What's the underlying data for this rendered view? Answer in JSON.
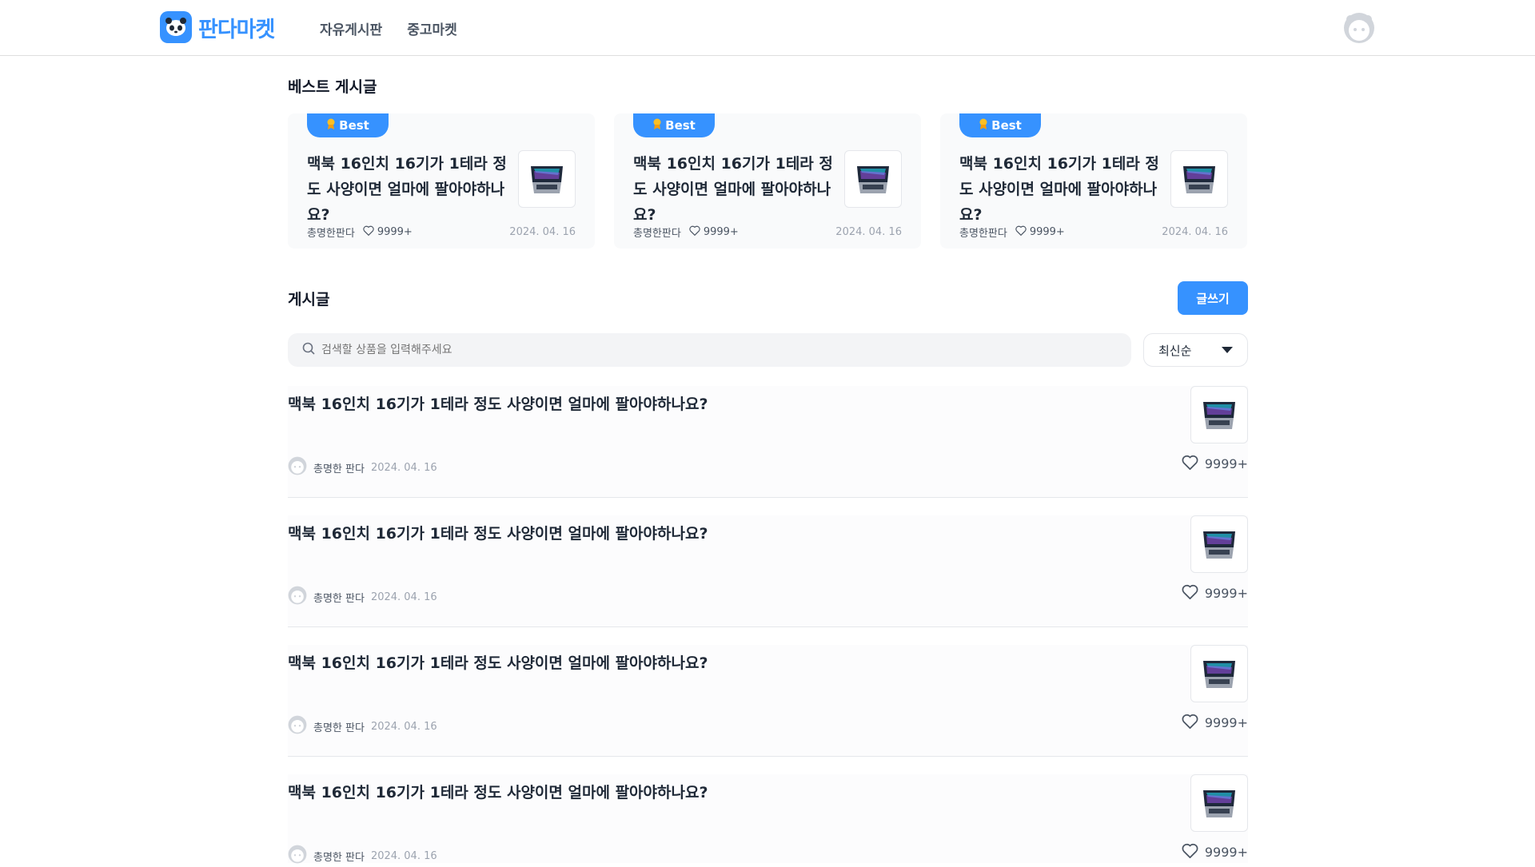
{
  "header": {
    "logo_text": "판다마켓",
    "nav": [
      "자유게시판",
      "중고마켓"
    ]
  },
  "best": {
    "title": "베스트 게시글",
    "badge_label": "Best",
    "cards": [
      {
        "title": "맥북 16인치 16기가 1테라 정도 사양이면 얼마에 팔아야하나요?",
        "author": "총명한판다",
        "likes": "9999+",
        "date": "2024. 04. 16"
      },
      {
        "title": "맥북 16인치 16기가 1테라 정도 사양이면 얼마에 팔아야하나요?",
        "author": "총명한판다",
        "likes": "9999+",
        "date": "2024. 04. 16"
      },
      {
        "title": "맥북 16인치 16기가 1테라 정도 사양이면 얼마에 팔아야하나요?",
        "author": "총명한판다",
        "likes": "9999+",
        "date": "2024. 04. 16"
      }
    ]
  },
  "posts": {
    "title": "게시글",
    "write_label": "글쓰기",
    "search_placeholder": "검색할 상품을 입력해주세요",
    "sort_label": "최신순",
    "items": [
      {
        "title": "맥북 16인치 16기가 1테라 정도 사양이면 얼마에 팔아야하나요?",
        "author": "총명한 판다",
        "date": "2024. 04. 16",
        "likes": "9999+"
      },
      {
        "title": "맥북 16인치 16기가 1테라 정도 사양이면 얼마에 팔아야하나요?",
        "author": "총명한 판다",
        "date": "2024. 04. 16",
        "likes": "9999+"
      },
      {
        "title": "맥북 16인치 16기가 1테라 정도 사양이면 얼마에 팔아야하나요?",
        "author": "총명한 판다",
        "date": "2024. 04. 16",
        "likes": "9999+"
      },
      {
        "title": "맥북 16인치 16기가 1테라 정도 사양이면 얼마에 팔아야하나요?",
        "author": "총명한 판다",
        "date": "2024. 04. 16",
        "likes": "9999+"
      }
    ]
  },
  "colors": {
    "accent": "#3692ff",
    "badge_medal": "#fbbf24"
  },
  "icons": [
    "panda-logo-icon",
    "avatar-icon",
    "medal-icon",
    "heart-icon",
    "search-icon",
    "laptop-thumbnail",
    "caret-down-icon"
  ]
}
